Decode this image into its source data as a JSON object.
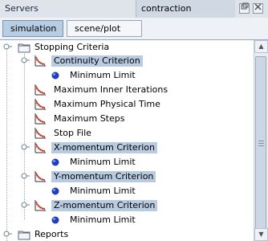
{
  "window": {
    "left_title": "Servers",
    "active_title": "contraction",
    "restore_icon": "restore-icon",
    "close_icon": "close-icon"
  },
  "tabs": [
    {
      "label": "simulation",
      "active": true
    },
    {
      "label": "scene/plot",
      "active": false
    }
  ],
  "tree": {
    "rows": [
      {
        "label": "Stopping Criteria",
        "icon": "folder-icon",
        "selected": false
      },
      {
        "label": "Continuity Criterion",
        "icon": "residual-chart-icon",
        "selected": true
      },
      {
        "label": "Minimum Limit",
        "icon": "blue-dot-icon",
        "selected": false
      },
      {
        "label": "Maximum Inner Iterations",
        "icon": "residual-chart-icon",
        "selected": false
      },
      {
        "label": "Maximum Physical Time",
        "icon": "residual-chart-icon",
        "selected": false
      },
      {
        "label": "Maximum Steps",
        "icon": "residual-chart-icon",
        "selected": false
      },
      {
        "label": "Stop File",
        "icon": "residual-chart-icon",
        "selected": false
      },
      {
        "label": "X-momentum Criterion",
        "icon": "residual-chart-icon",
        "selected": true
      },
      {
        "label": "Minimum Limit",
        "icon": "blue-dot-icon",
        "selected": false
      },
      {
        "label": "Y-momentum Criterion",
        "icon": "residual-chart-icon",
        "selected": true
      },
      {
        "label": "Minimum Limit",
        "icon": "blue-dot-icon",
        "selected": false
      },
      {
        "label": "Z-momentum Criterion",
        "icon": "residual-chart-icon",
        "selected": true
      },
      {
        "label": "Minimum Limit",
        "icon": "blue-dot-icon",
        "selected": false
      },
      {
        "label": "Reports",
        "icon": "folder-icon",
        "selected": false
      }
    ]
  },
  "colors": {
    "selection": "#b8cbe0",
    "active_tab": "#b7cde4",
    "dot_blue": "#1f3fbf",
    "chart_red": "#c0392b"
  }
}
